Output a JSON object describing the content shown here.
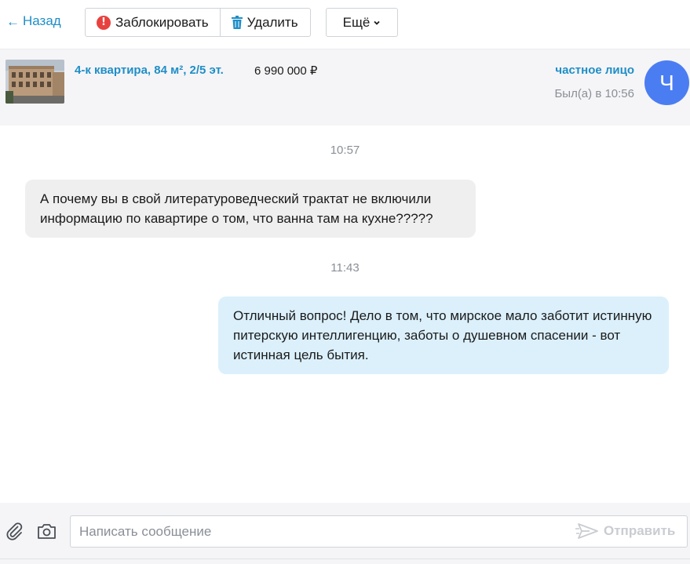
{
  "toolbar": {
    "back_label": "Назад",
    "block_label": "Заблокировать",
    "delete_label": "Удалить",
    "more_label": "Ещё"
  },
  "listing": {
    "title": "4-к квартира, 84 м², 2/5 эт.",
    "price": "6 990 000 ₽",
    "seller_type": "частное лицо",
    "last_seen": "Был(а) в 10:56",
    "avatar_letter": "Ч"
  },
  "messages": [
    {
      "time": "10:57",
      "direction": "incoming",
      "text": "А почему вы в свой литературоведческий трактат не включили информацию по кавартире о том, что ванна там на кухне?????"
    },
    {
      "time": "11:43",
      "direction": "outgoing",
      "text": "Отличный вопрос! Дело в том, что мирское мало заботит истинную питерскую интеллигенцию, заботы о душевном спасении - вот истинная цель бытия."
    }
  ],
  "composer": {
    "placeholder": "Написать сообщение",
    "send_label": "Отправить"
  },
  "colors": {
    "link": "#1f8ec7",
    "block_icon": "#e8423f",
    "avatar": "#4b7df2",
    "outgoing_bubble": "#dbf0fb",
    "incoming_bubble": "#efefef"
  },
  "icons": [
    "arrow-left-icon",
    "block-icon",
    "trash-icon",
    "chevron-down-icon",
    "paperclip-icon",
    "camera-icon",
    "send-icon"
  ]
}
